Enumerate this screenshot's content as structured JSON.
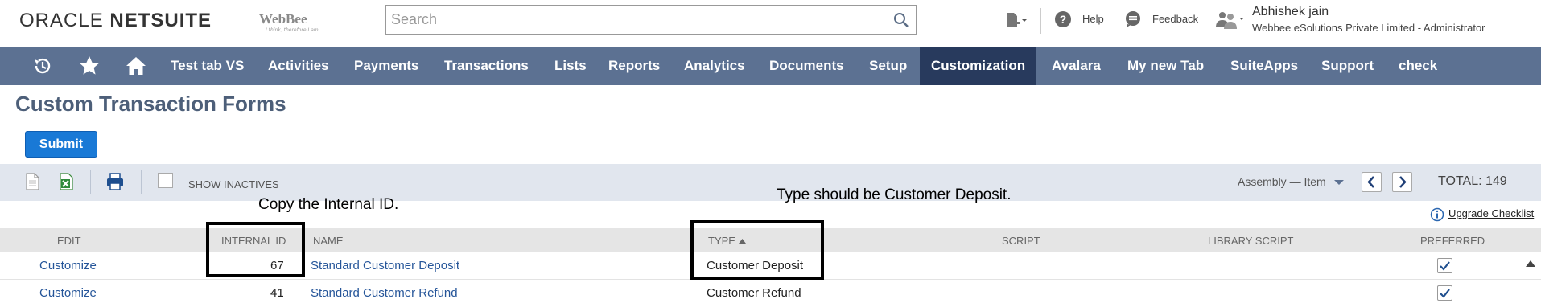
{
  "header": {
    "brand_oracle": "ORACLE",
    "brand_netsuite": "NETSUITE",
    "logo_webbee": "WebBee",
    "logo_tagline": "I think, therefore I am",
    "search_placeholder": "Search",
    "help_label": "Help",
    "feedback_label": "Feedback",
    "user_name": "Abhishek jain",
    "user_role": "Webbee eSolutions Private Limited - Administrator"
  },
  "nav": {
    "items": [
      {
        "label": "Test tab VS"
      },
      {
        "label": "Activities"
      },
      {
        "label": "Payments"
      },
      {
        "label": "Transactions"
      },
      {
        "label": "Lists"
      },
      {
        "label": "Reports"
      },
      {
        "label": "Analytics"
      },
      {
        "label": "Documents"
      },
      {
        "label": "Setup"
      },
      {
        "label": "Customization"
      },
      {
        "label": "Avalara"
      },
      {
        "label": "My new Tab"
      },
      {
        "label": "SuiteApps"
      },
      {
        "label": "Support"
      },
      {
        "label": "check"
      }
    ],
    "active": "Customization"
  },
  "page": {
    "title": "Custom Transaction Forms",
    "submit_label": "Submit"
  },
  "toolbar": {
    "show_inactives_label": "SHOW INACTIVES",
    "filter_label": "Assembly — Item",
    "total_label": "TOTAL: 149"
  },
  "annotations": {
    "copy_id": "Copy the Internal ID.",
    "type_note": "Type should be Customer Deposit."
  },
  "upgrade_link": "Upgrade Checklist",
  "table": {
    "columns": {
      "edit": "EDIT",
      "internal_id": "INTERNAL ID",
      "name": "NAME",
      "type": "TYPE",
      "script": "SCRIPT",
      "library_script": "LIBRARY SCRIPT",
      "preferred": "PREFERRED"
    },
    "rows": [
      {
        "edit": "Customize",
        "internal_id": "67",
        "name": "Standard Customer Deposit",
        "type": "Customer Deposit",
        "preferred": true
      },
      {
        "edit": "Customize",
        "internal_id": "41",
        "name": "Standard Customer Refund",
        "type": "Customer Refund",
        "preferred": true
      }
    ]
  },
  "colors": {
    "nav_bg": "#5c7192",
    "nav_active": "#283a5d",
    "link": "#255599",
    "submit": "#1979d6"
  }
}
